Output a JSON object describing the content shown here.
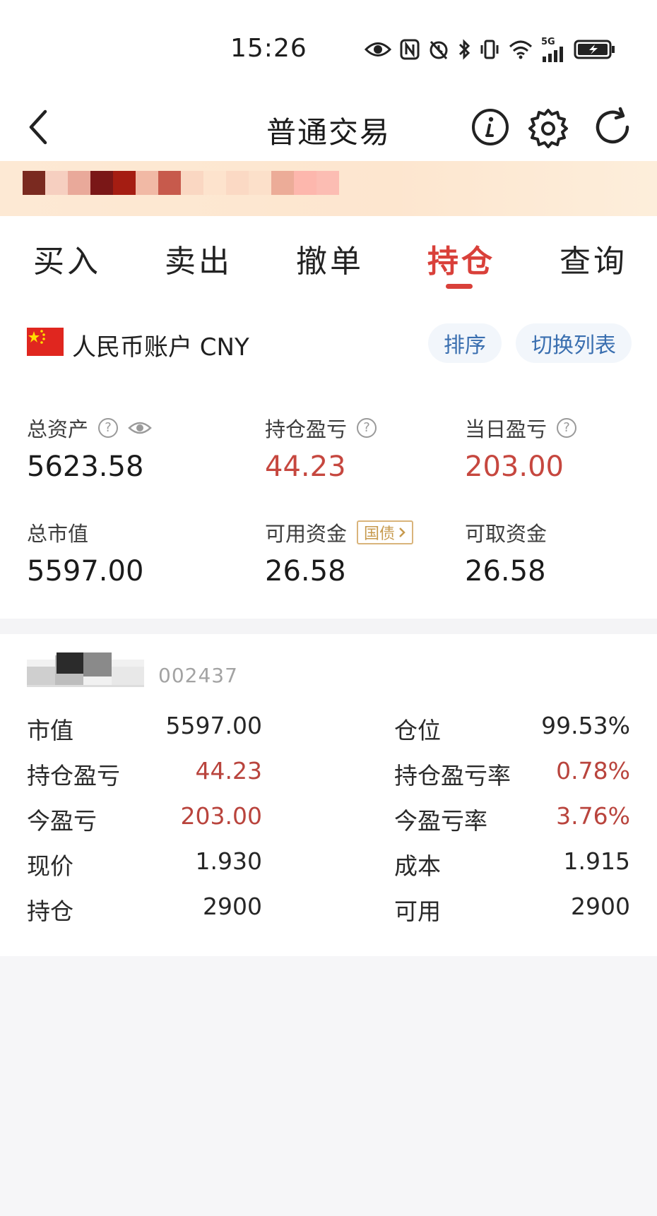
{
  "status_bar": {
    "time": "15:26",
    "network_label": "5G",
    "icons": [
      "eye-icon",
      "nfc-icon",
      "alarm-icon",
      "bluetooth-icon",
      "vibrate-icon",
      "wifi-icon",
      "signal-icon",
      "battery-charging-icon"
    ]
  },
  "nav": {
    "title": "普通交易",
    "back_icon": "chevron-left-icon",
    "info_icon": "info-icon",
    "settings_icon": "gear-icon",
    "refresh_icon": "refresh-icon"
  },
  "tabs": [
    {
      "label": "买入",
      "active": false
    },
    {
      "label": "卖出",
      "active": false
    },
    {
      "label": "撤单",
      "active": false
    },
    {
      "label": "持仓",
      "active": true
    },
    {
      "label": "查询",
      "active": false
    }
  ],
  "account": {
    "flag_icon": "china-flag-icon",
    "title": "人民币账户 CNY",
    "sort_label": "排序",
    "switch_label": "切换列表",
    "metrics": {
      "total_assets": {
        "label": "总资产",
        "value": "5623.58"
      },
      "position_pnl": {
        "label": "持仓盈亏",
        "value": "44.23"
      },
      "daily_pnl": {
        "label": "当日盈亏",
        "value": "203.00"
      },
      "market_value": {
        "label": "总市值",
        "value": "5597.00"
      },
      "available_funds": {
        "label": "可用资金",
        "value": "26.58",
        "tag": "国债"
      },
      "withdrawable_funds": {
        "label": "可取资金",
        "value": "26.58"
      }
    }
  },
  "holding": {
    "code": "002437",
    "rows": [
      {
        "left_label": "市值",
        "left_value": "5597.00",
        "right_label": "仓位",
        "right_value": "99.53%"
      },
      {
        "left_label": "持仓盈亏",
        "left_value": "44.23",
        "right_label": "持仓盈亏率",
        "right_value": "0.78%"
      },
      {
        "left_label": "今盈亏",
        "left_value": "203.00",
        "right_label": "今盈亏率",
        "right_value": "3.76%"
      },
      {
        "left_label": "现价",
        "left_value": "1.930",
        "right_label": "成本",
        "right_value": "1.915"
      },
      {
        "left_label": "持仓",
        "left_value": "2900",
        "right_label": "可用",
        "right_value": "2900"
      }
    ]
  },
  "colors": {
    "accent_red": "#d9403a",
    "value_red": "#c6473f",
    "link_blue": "#3a6fb0",
    "bond_gold": "#c79a4e"
  }
}
